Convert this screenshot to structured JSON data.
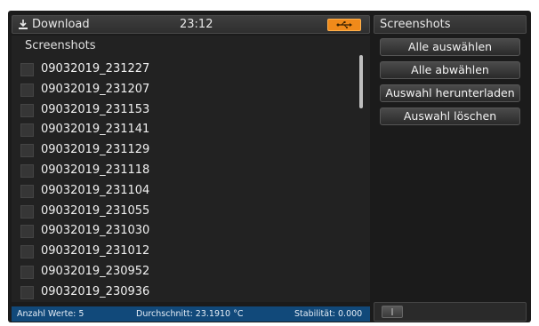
{
  "header": {
    "title": "Download",
    "time": "23:12",
    "usb_icon": "usb-icon",
    "usb_color": "#f08a1a",
    "download_icon": "download-icon"
  },
  "right_panel": {
    "title": "Screenshots",
    "buttons": [
      {
        "label": "Alle auswählen"
      },
      {
        "label": "Alle abwählen"
      },
      {
        "label": "Auswahl herunterladen"
      },
      {
        "label": "Auswahl löschen"
      }
    ]
  },
  "list": {
    "header": "Screenshots",
    "items": [
      {
        "label": "09032019_231227",
        "checked": false
      },
      {
        "label": "09032019_231207",
        "checked": false
      },
      {
        "label": "09032019_231153",
        "checked": false
      },
      {
        "label": "09032019_231141",
        "checked": false
      },
      {
        "label": "09032019_231129",
        "checked": false
      },
      {
        "label": "09032019_231118",
        "checked": false
      },
      {
        "label": "09032019_231104",
        "checked": false
      },
      {
        "label": "09032019_231055",
        "checked": false
      },
      {
        "label": "09032019_231030",
        "checked": false
      },
      {
        "label": "09032019_231012",
        "checked": false
      },
      {
        "label": "09032019_230952",
        "checked": false
      },
      {
        "label": "09032019_230936",
        "checked": false
      }
    ]
  },
  "status": {
    "count": "Anzahl Werte: 5",
    "average": "Durchschnitt: 23.1910 °C",
    "stability": "Stabilität: 0.000",
    "bar_color": "#11497a"
  }
}
